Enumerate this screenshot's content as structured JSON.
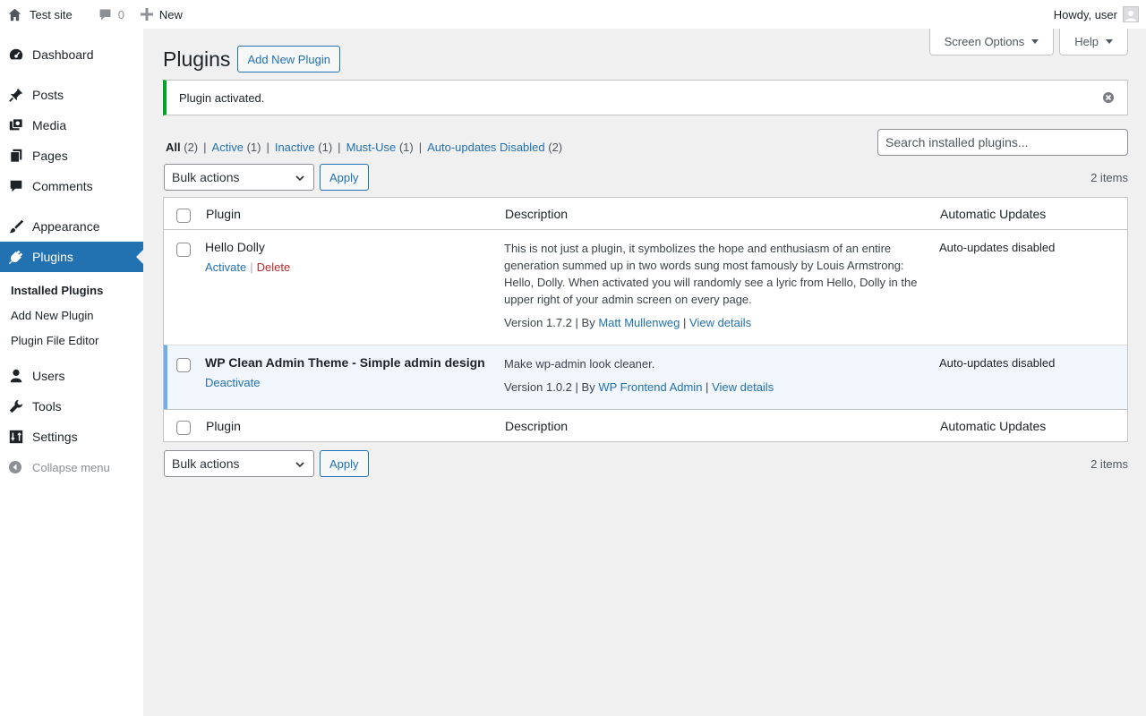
{
  "adminbar": {
    "site_name": "Test site",
    "comments_count": "0",
    "new_label": "New",
    "howdy": "Howdy, user"
  },
  "sidebar": {
    "items": [
      {
        "label": "Dashboard"
      },
      {
        "label": "Posts"
      },
      {
        "label": "Media"
      },
      {
        "label": "Pages"
      },
      {
        "label": "Comments"
      },
      {
        "label": "Appearance"
      },
      {
        "label": "Plugins"
      },
      {
        "label": "Users"
      },
      {
        "label": "Tools"
      },
      {
        "label": "Settings"
      }
    ],
    "submenu": [
      {
        "label": "Installed Plugins"
      },
      {
        "label": "Add New Plugin"
      },
      {
        "label": "Plugin File Editor"
      }
    ],
    "collapse_label": "Collapse menu"
  },
  "screen_meta": {
    "screen_options": "Screen Options",
    "help": "Help"
  },
  "page": {
    "title": "Plugins",
    "add_new": "Add New Plugin",
    "notice": "Plugin activated."
  },
  "filters": [
    {
      "label": "All",
      "count": "(2)"
    },
    {
      "label": "Active",
      "count": "(1)"
    },
    {
      "label": "Inactive",
      "count": "(1)"
    },
    {
      "label": "Must-Use",
      "count": "(1)"
    },
    {
      "label": "Auto-updates Disabled",
      "count": "(2)"
    }
  ],
  "separator": "|",
  "search": {
    "placeholder": "Search installed plugins..."
  },
  "tablenav": {
    "bulk_label": "Bulk actions",
    "apply": "Apply",
    "items_count": "2 items"
  },
  "table": {
    "headers": {
      "plugin": "Plugin",
      "description": "Description",
      "auto": "Automatic Updates"
    },
    "rows": [
      {
        "name": "Hello Dolly",
        "actions": [
          "Activate",
          "Delete"
        ],
        "description": "This is not just a plugin, it symbolizes the hope and enthusiasm of an entire generation summed up in two words sung most famously by Louis Armstrong: Hello, Dolly. When activated you will randomly see a lyric from Hello, Dolly in the upper right of your admin screen on every page.",
        "version": "Version 1.7.2",
        "by": "By",
        "author": "Matt Mullenweg",
        "details": "View details",
        "auto": "Auto-updates disabled"
      },
      {
        "name": "WP Clean Admin Theme - Simple admin design",
        "actions": [
          "Deactivate"
        ],
        "description": "Make wp-admin look cleaner.",
        "version": "Version 1.0.2",
        "by": "By",
        "author": "WP Frontend Admin",
        "details": "View details",
        "auto": "Auto-updates disabled"
      }
    ]
  },
  "colors": {
    "accent": "#2271b1",
    "success": "#00a32a",
    "active_row_bg": "#f0f6fc",
    "active_row_border": "#72aee6",
    "delete": "#b32d2e"
  }
}
